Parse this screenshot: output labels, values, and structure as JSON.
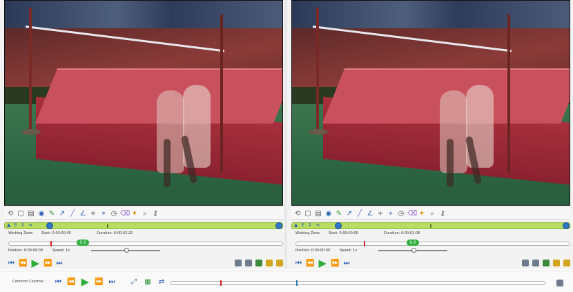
{
  "left_pane": {
    "working_zone_label": "Working Zone:",
    "start_label": "Start: 0:00:00:00",
    "duration_label": "Duration: 0:00:02:20",
    "position_label": "Position: 0:00:00:00",
    "speed_label": "Speed: 1x",
    "badge": "0.0"
  },
  "right_pane": {
    "working_zone_label": "Working Zone:",
    "start_label": "Start: 0:00:00:00",
    "duration_label": "Duration: 0:00:02:08",
    "position_label": "Position: 0:00:00:00",
    "speed_label": "Speed: 1x",
    "badge": "0.0"
  },
  "common_controls": {
    "label": "Common Controls :"
  },
  "toolbar_icons": [
    "history-icon",
    "new-icon",
    "grid-icon",
    "eye-icon",
    "pencil-icon",
    "arrow-icon",
    "line-icon",
    "angle-icon",
    "cross-icon",
    "crosshair-icon",
    "clock-icon",
    "eraser-icon",
    "magnet-icon",
    "magnifier-icon",
    "key-icon"
  ],
  "colors": {
    "play_green": "#2fae3c",
    "control_blue": "#2b5fb8",
    "working_zone_green": "#b9dc63"
  }
}
